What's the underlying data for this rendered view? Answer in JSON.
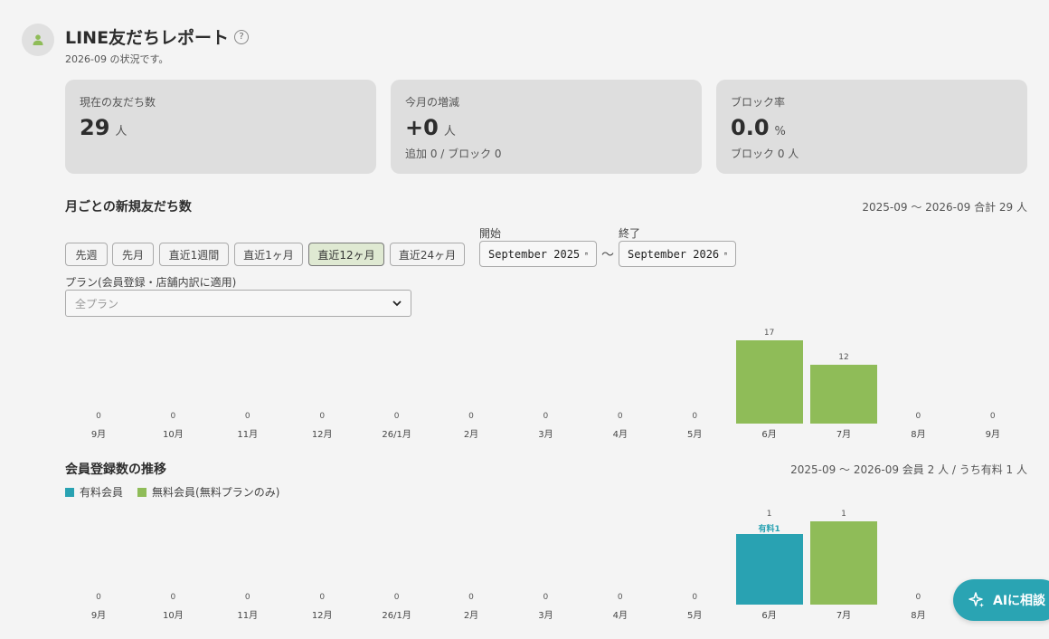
{
  "header": {
    "title": "LINE友だちレポート",
    "help": "?",
    "subtitle": "2026-09 の状況です。"
  },
  "kpis": [
    {
      "label": "現在の友だち数",
      "value": "29",
      "unit": "人",
      "sub": ""
    },
    {
      "label": "今月の増減",
      "value": "+0",
      "unit": "人",
      "sub": "追加 0 / ブロック 0"
    },
    {
      "label": "ブロック率",
      "value": "0.0",
      "unit": "%",
      "sub": "ブロック 0 人"
    }
  ],
  "section1": {
    "title": "月ごとの新規友だち数",
    "summary": "2025-09 〜 2026-09 合計 29 人"
  },
  "filters": {
    "buttons": [
      "先週",
      "先月",
      "直近1週間",
      "直近1ヶ月",
      "直近12ヶ月",
      "直近24ヶ月"
    ],
    "active": "直近12ヶ月",
    "start_label": "開始",
    "start_value": "September 2025",
    "end_label": "終了",
    "end_value": "September 2026",
    "tilde": "〜",
    "plan_label": "プラン(会員登録・店舗内訳に適用)",
    "plan_placeholder": "全プラン"
  },
  "section2": {
    "title": "会員登録数の推移",
    "summary": "2025-09 〜 2026-09 会員 2 人 / うち有料 1 人",
    "legend": [
      "有料会員",
      "無料会員(無料プランのみ)"
    ],
    "paid_tag": "有料1"
  },
  "colors": {
    "green": "#8fbc58",
    "teal": "#29a2b2"
  },
  "ai_button": {
    "label": "AIに相談"
  },
  "chart_data": [
    {
      "type": "bar",
      "categories": [
        "9月",
        "10月",
        "11月",
        "12月",
        "26/1月",
        "2月",
        "3月",
        "4月",
        "5月",
        "6月",
        "7月",
        "8月",
        "9月"
      ],
      "values": [
        0,
        0,
        0,
        0,
        0,
        0,
        0,
        0,
        0,
        17,
        12,
        0,
        0
      ],
      "title": "月ごとの新規友だち数"
    },
    {
      "type": "bar",
      "categories": [
        "9月",
        "10月",
        "11月",
        "12月",
        "26/1月",
        "2月",
        "3月",
        "4月",
        "5月",
        "6月",
        "7月",
        "8月"
      ],
      "series": [
        {
          "name": "有料会員",
          "values": [
            0,
            0,
            0,
            0,
            0,
            0,
            0,
            0,
            0,
            1,
            0,
            0
          ]
        },
        {
          "name": "無料会員(無料プランのみ)",
          "values": [
            0,
            0,
            0,
            0,
            0,
            0,
            0,
            0,
            0,
            0,
            1,
            0
          ]
        }
      ],
      "totals": [
        0,
        0,
        0,
        0,
        0,
        0,
        0,
        0,
        0,
        1,
        1,
        0
      ],
      "title": "会員登録数の推移",
      "stacked": true
    }
  ]
}
